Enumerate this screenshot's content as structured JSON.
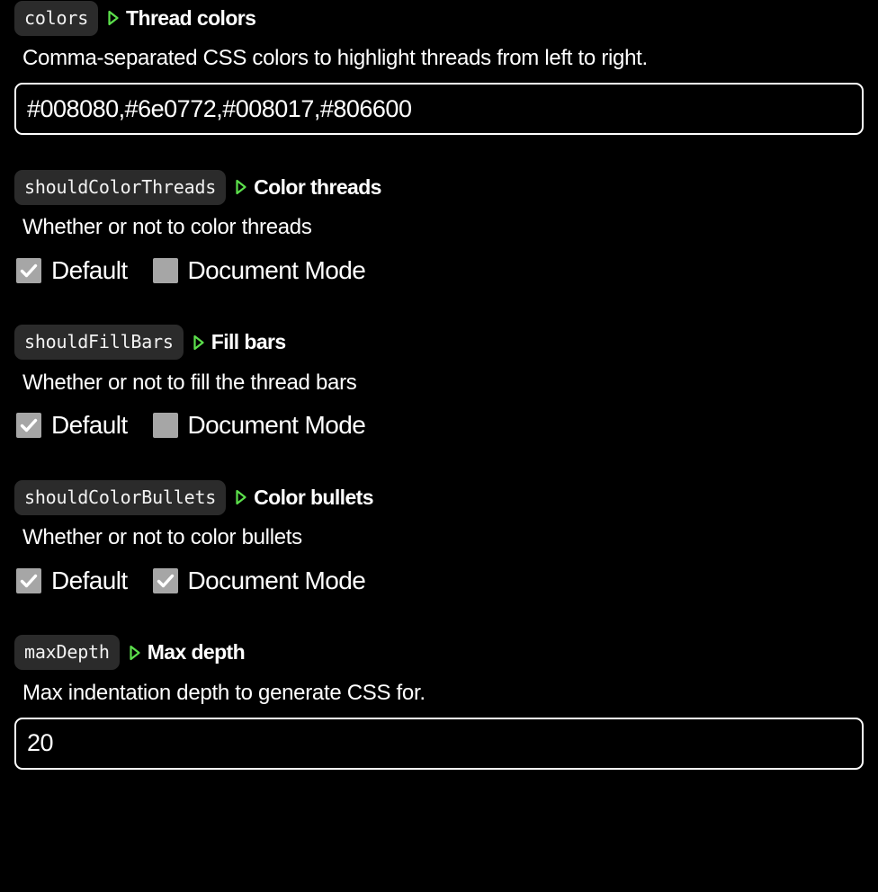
{
  "theme": {
    "background": "#000000",
    "text": "#ffffff",
    "badge_bg": "#2b2b2b",
    "badge_text": "#f2f2f2",
    "marker_green": "#5ce04c",
    "checkbox_fill": "#a6a6a6",
    "input_border": "#ffffff"
  },
  "settings": [
    {
      "key": "colors",
      "title": "Thread colors",
      "marker_icon": "triangle-right-icon",
      "description": "Comma-separated CSS colors to highlight threads from left to right.",
      "control": "text",
      "value": "#008080,#6e0772,#008017,#806600",
      "placeholder": ""
    },
    {
      "key": "shouldColorThreads",
      "title": "Color threads",
      "marker_icon": "triangle-right-icon",
      "description": "Whether or not to color threads",
      "control": "checkboxes",
      "checkboxes": [
        {
          "label": "Default",
          "checked": true
        },
        {
          "label": "Document Mode",
          "checked": false
        }
      ]
    },
    {
      "key": "shouldFillBars",
      "title": "Fill bars",
      "marker_icon": "triangle-right-icon",
      "description": "Whether or not to fill the thread bars",
      "control": "checkboxes",
      "checkboxes": [
        {
          "label": "Default",
          "checked": true
        },
        {
          "label": "Document Mode",
          "checked": false
        }
      ]
    },
    {
      "key": "shouldColorBullets",
      "title": "Color bullets",
      "marker_icon": "triangle-right-icon",
      "description": "Whether or not to color bullets",
      "control": "checkboxes",
      "checkboxes": [
        {
          "label": "Default",
          "checked": true
        },
        {
          "label": "Document Mode",
          "checked": true
        }
      ]
    },
    {
      "key": "maxDepth",
      "title": "Max depth",
      "marker_icon": "triangle-right-icon",
      "description": "Max indentation depth to generate CSS for.",
      "control": "text",
      "value": "20",
      "placeholder": ""
    }
  ]
}
